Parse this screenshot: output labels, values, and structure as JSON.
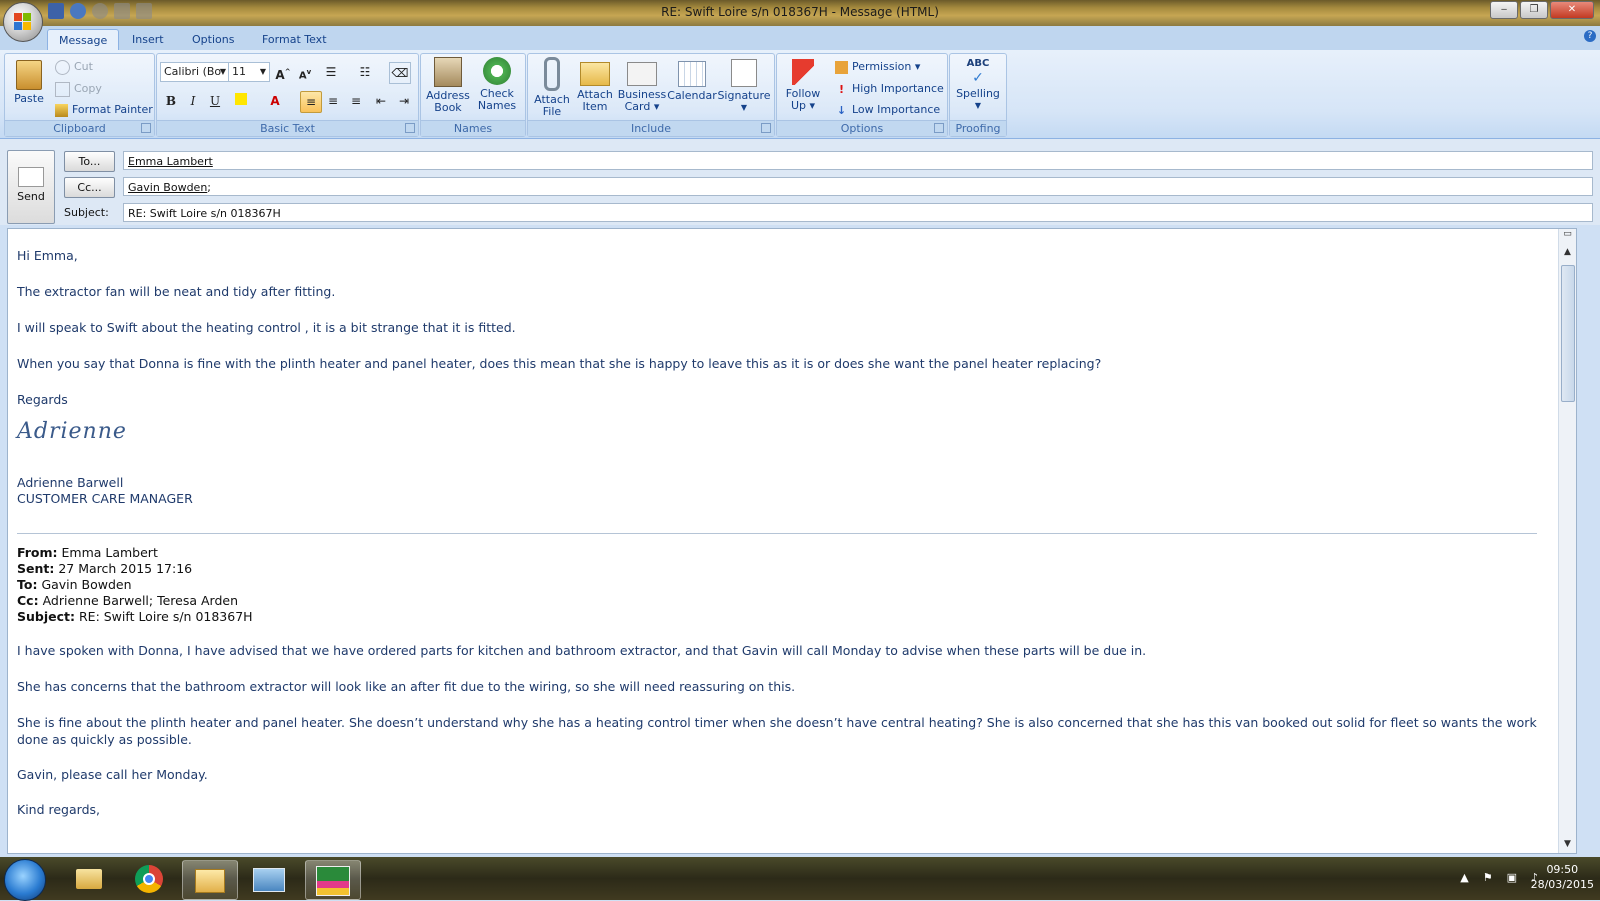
{
  "window": {
    "title": "RE: Swift Loire s/n 018367H - Message (HTML)",
    "min_label": "‒",
    "max_label": "❐",
    "close_label": "✕"
  },
  "ribbon_tabs": [
    "Message",
    "Insert",
    "Options",
    "Format Text"
  ],
  "clipboard": {
    "paste": "Paste",
    "cut": "Cut",
    "copy": "Copy",
    "format_painter": "Format Painter",
    "group_label": "Clipboard"
  },
  "basic_text": {
    "font_name": "Calibri (Bo",
    "font_size": "11",
    "bold": "B",
    "italic": "I",
    "underline": "U",
    "group_label": "Basic Text"
  },
  "names": {
    "address_book": [
      "Address",
      "Book"
    ],
    "check_names": [
      "Check",
      "Names"
    ],
    "group_label": "Names"
  },
  "include": {
    "attach_file": [
      "Attach",
      "File"
    ],
    "attach_item": [
      "Attach",
      "Item"
    ],
    "business_card": [
      "Business",
      "Card ▾"
    ],
    "calendar": "Calendar",
    "signature": "Signature",
    "group_label": "Include"
  },
  "options": {
    "follow_up": [
      "Follow",
      "Up ▾"
    ],
    "permission": "Permission ▾",
    "high_importance": "High Importance",
    "low_importance": "Low Importance",
    "group_label": "Options"
  },
  "proofing": {
    "spelling": "Spelling",
    "group_label": "Proofing"
  },
  "compose": {
    "send": "Send",
    "to_button": "To...",
    "cc_button": "Cc...",
    "subject_label": "Subject:",
    "to_value": "Emma Lambert",
    "cc_value": "Gavin Bowden",
    "cc_suffix": ";",
    "subject_value": "RE: Swift Loire s/n 018367H"
  },
  "message": {
    "greeting": "Hi Emma,",
    "p1": "The extractor fan will be neat and tidy after fitting.",
    "p2": "I will speak to Swift about the heating control , it is a bit strange that it is fitted.",
    "p3": "When you say that Donna is fine with the plinth heater and panel heater, does this mean that she is happy to leave this as it is or does she want the panel heater replacing?",
    "regards": "Regards",
    "signature_script": "Adrienne",
    "sig_name": "Adrienne Barwell",
    "sig_title": "CUSTOMER CARE MANAGER"
  },
  "quoted": {
    "from_label": "From:",
    "from": "Emma Lambert",
    "sent_label": "Sent:",
    "sent": "27 March 2015 17:16",
    "to_label": "To:",
    "to": "Gavin Bowden",
    "cc_label": "Cc:",
    "cc": "Adrienne Barwell; Teresa Arden",
    "subject_label": "Subject:",
    "subject": "RE: Swift Loire s/n 018367H",
    "q1": "I have spoken with Donna, I have advised that we have ordered parts for kitchen and bathroom extractor, and that Gavin will call Monday to advise when these parts will be due in.",
    "q2": "She has concerns that the bathroom extractor will look like an after fit due to the wiring, so she will need reassuring on this.",
    "q3": "She is fine about the plinth heater and panel heater. She doesn’t understand why she has a heating control timer when she doesn’t have central heating? She is also concerned that she has this van booked out solid for fleet so wants the work done as quickly as possible.",
    "q4": "Gavin, please call her Monday.",
    "q5": "Kind regards,"
  },
  "taskbar": {
    "time": "09:50",
    "date": "28/03/2015",
    "apps": [
      "windows-explorer",
      "google-chrome",
      "outlook",
      "image-viewer",
      "sage"
    ]
  }
}
